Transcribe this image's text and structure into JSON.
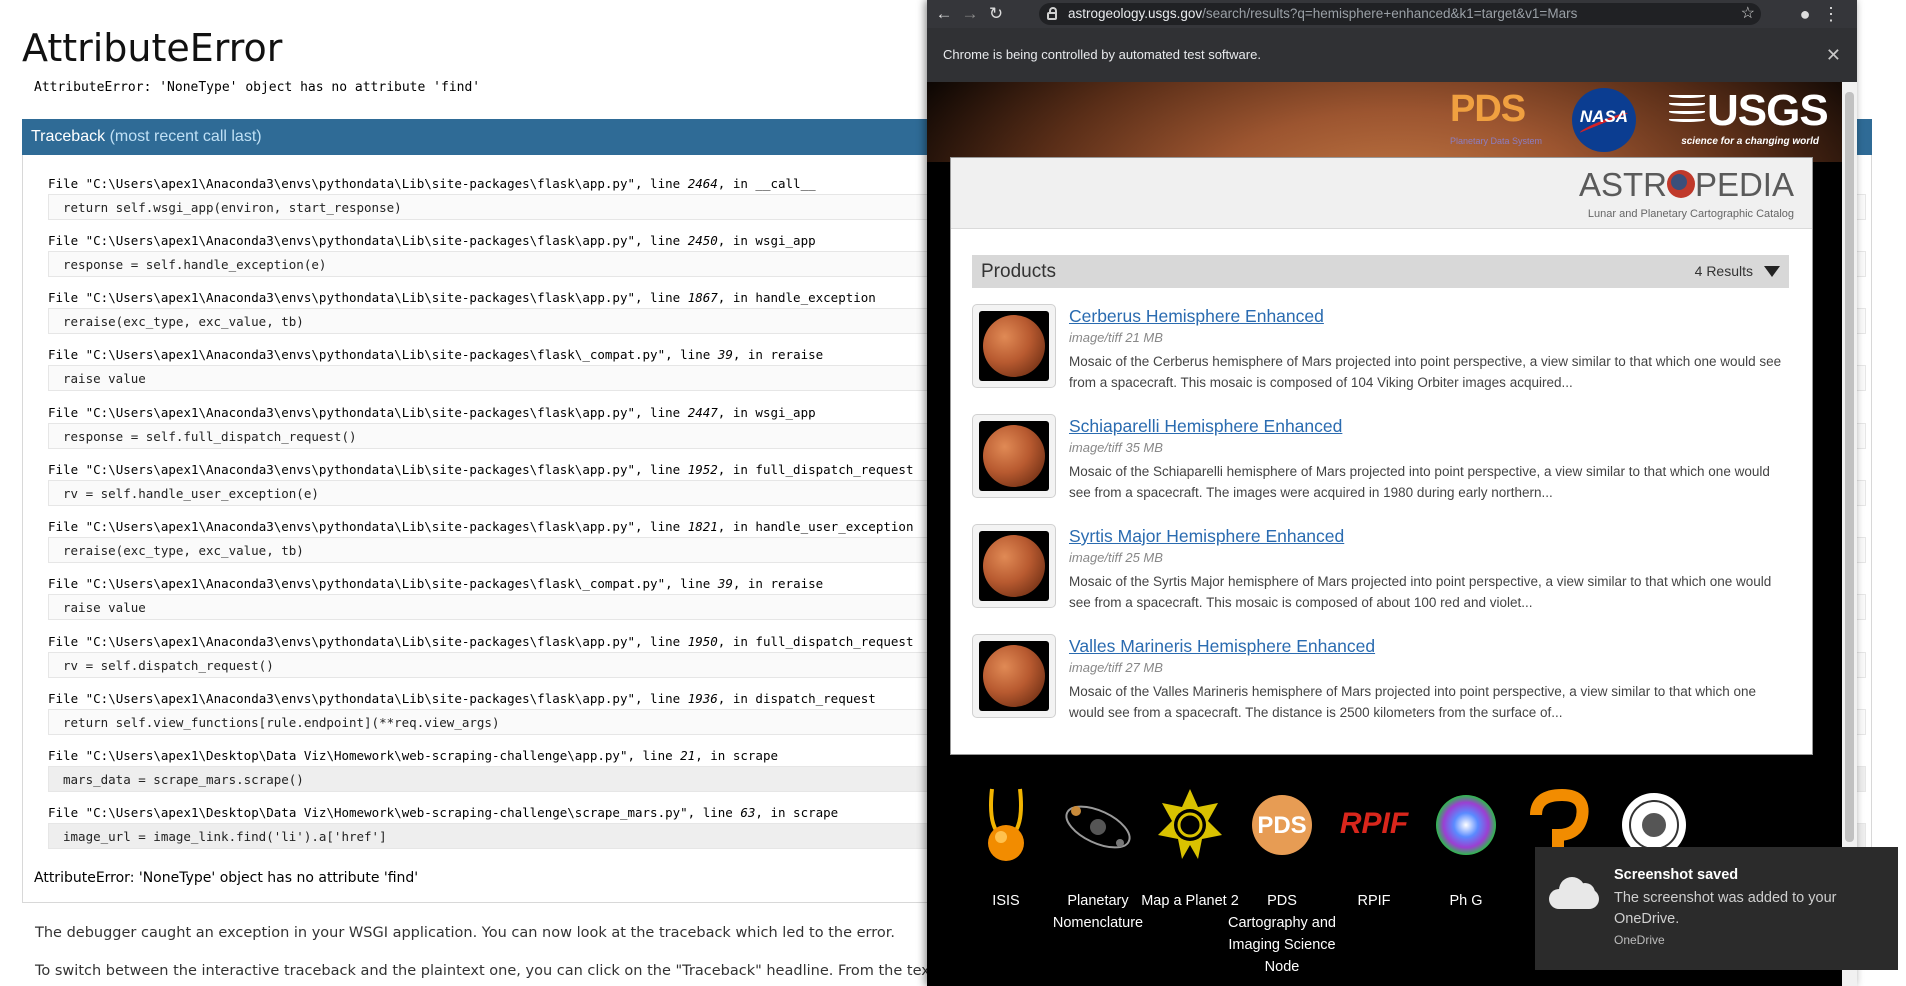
{
  "debugger": {
    "title": "AttributeError",
    "error_message": "AttributeError: 'NoneType' object has no attribute 'find'",
    "traceback_header": "Traceback",
    "traceback_subheader": "(most recent call last)",
    "frames": [
      {
        "file_prefix": "File \"C:\\Users\\apex1\\Anaconda3\\envs\\pythondata\\Lib\\site-packages\\flask\\app.py\", line ",
        "line": "2464",
        "func": ", in __call__",
        "code": "return self.wsgi_app(environ, start_response)"
      },
      {
        "file_prefix": "File \"C:\\Users\\apex1\\Anaconda3\\envs\\pythondata\\Lib\\site-packages\\flask\\app.py\", line ",
        "line": "2450",
        "func": ", in wsgi_app",
        "code": "response = self.handle_exception(e)"
      },
      {
        "file_prefix": "File \"C:\\Users\\apex1\\Anaconda3\\envs\\pythondata\\Lib\\site-packages\\flask\\app.py\", line ",
        "line": "1867",
        "func": ", in handle_exception",
        "code": "reraise(exc_type, exc_value, tb)"
      },
      {
        "file_prefix": "File \"C:\\Users\\apex1\\Anaconda3\\envs\\pythondata\\Lib\\site-packages\\flask\\_compat.py\", line ",
        "line": "39",
        "func": ", in reraise",
        "code": "raise value"
      },
      {
        "file_prefix": "File \"C:\\Users\\apex1\\Anaconda3\\envs\\pythondata\\Lib\\site-packages\\flask\\app.py\", line ",
        "line": "2447",
        "func": ", in wsgi_app",
        "code": "response = self.full_dispatch_request()"
      },
      {
        "file_prefix": "File \"C:\\Users\\apex1\\Anaconda3\\envs\\pythondata\\Lib\\site-packages\\flask\\app.py\", line ",
        "line": "1952",
        "func": ", in full_dispatch_request",
        "code": "rv = self.handle_user_exception(e)"
      },
      {
        "file_prefix": "File \"C:\\Users\\apex1\\Anaconda3\\envs\\pythondata\\Lib\\site-packages\\flask\\app.py\", line ",
        "line": "1821",
        "func": ", in handle_user_exception",
        "code": "reraise(exc_type, exc_value, tb)"
      },
      {
        "file_prefix": "File \"C:\\Users\\apex1\\Anaconda3\\envs\\pythondata\\Lib\\site-packages\\flask\\_compat.py\", line ",
        "line": "39",
        "func": ", in reraise",
        "code": "raise value"
      },
      {
        "file_prefix": "File \"C:\\Users\\apex1\\Anaconda3\\envs\\pythondata\\Lib\\site-packages\\flask\\app.py\", line ",
        "line": "1950",
        "func": ", in full_dispatch_request",
        "code": "rv = self.dispatch_request()"
      },
      {
        "file_prefix": "File \"C:\\Users\\apex1\\Anaconda3\\envs\\pythondata\\Lib\\site-packages\\flask\\app.py\", line ",
        "line": "1936",
        "func": ", in dispatch_request",
        "code": "return self.view_functions[rule.endpoint](**req.view_args)"
      },
      {
        "file_prefix": "File \"C:\\Users\\apex1\\Desktop\\Data Viz\\Homework\\web-scraping-challenge\\app.py\", line ",
        "line": "21",
        "func": ", in scrape",
        "code": "mars_data = scrape_mars.scrape()"
      },
      {
        "file_prefix": "File \"C:\\Users\\apex1\\Desktop\\Data Viz\\Homework\\web-scraping-challenge\\scrape_mars.py\", line ",
        "line": "63",
        "func": ", in scrape",
        "code": "image_url = image_link.find('li').a['href']"
      }
    ],
    "final_error": "AttributeError: 'NoneType' object has no attribute 'find'",
    "paragraph1": "The debugger caught an exception in your WSGI application. You can now look at the traceback which led to the error.",
    "paragraph2": "To switch between the interactive traceback and the plaintext one, you can click on the \"Traceback\" headline. From the text traceback you can also create a paste of it. For code execution mouse-over the frame you want to debug and click on the"
  },
  "browser": {
    "nav_icons": [
      "back-icon",
      "forward-icon",
      "reload-icon"
    ],
    "url_host": "astrogeology.usgs.gov",
    "url_path": "/search/results?q=hemisphere+enhanced&k1=target&v1=Mars",
    "infobar_text": "Chrome is being controlled by automated test software.",
    "infobar_close": "✕"
  },
  "site": {
    "logos": {
      "pds_text": "PDS",
      "pds_sub": "Planetary Data System",
      "nasa_text": "NASA",
      "usgs_text": "USGS",
      "usgs_tagline": "science for a changing world"
    },
    "astropedia_pre": "ASTR",
    "astropedia_post": "PEDIA",
    "astropedia_tagline": "Lunar and Planetary Cartographic Catalog",
    "products_label": "Products",
    "results_count": "4 Results",
    "items": [
      {
        "title": "Cerberus Hemisphere Enhanced",
        "meta": "image/tiff 21 MB",
        "desc": "Mosaic of the Cerberus hemisphere of Mars projected into point perspective, a view similar to that which one would see from a spacecraft. This mosaic is composed of 104 Viking Orbiter images acquired..."
      },
      {
        "title": "Schiaparelli Hemisphere Enhanced",
        "meta": "image/tiff 35 MB",
        "desc": "Mosaic of the Schiaparelli hemisphere of Mars projected into point perspective, a view similar to that which one would see from a spacecraft. The images were acquired in 1980 during early northern..."
      },
      {
        "title": "Syrtis Major Hemisphere Enhanced",
        "meta": "image/tiff 25 MB",
        "desc": "Mosaic of the Syrtis Major hemisphere of Mars projected into point perspective, a view similar to that which one would see from a spacecraft. This mosaic is composed of about 100 red and violet..."
      },
      {
        "title": "Valles Marineris Hemisphere Enhanced",
        "meta": "image/tiff 27 MB",
        "desc": "Mosaic of the Valles Marineris hemisphere of Mars projected into point perspective, a view similar to that which one would see from a spacecraft. The distance is 2500 kilometers from the surface of..."
      }
    ],
    "footer_links": [
      {
        "label": "ISIS"
      },
      {
        "label": "Planetary Nomenclature"
      },
      {
        "label": "Map a Planet 2"
      },
      {
        "label": "PDS Cartography and Imaging Science Node"
      },
      {
        "label": "RPIF"
      },
      {
        "label": "Ph G"
      }
    ],
    "footer_pds_text": "PDS",
    "footer_rpif_text": "RPIF"
  },
  "toast": {
    "title": "Screenshot saved",
    "body": "The screenshot was added to your OneDrive.",
    "source": "OneDrive"
  }
}
